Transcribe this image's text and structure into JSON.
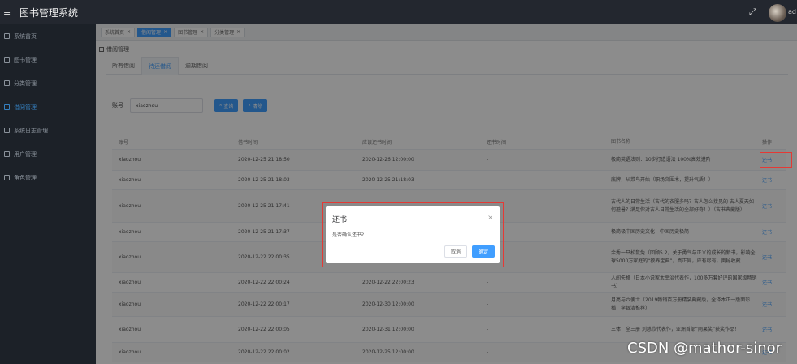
{
  "header": {
    "title": "图书管理系统",
    "menu_icon": "≡",
    "fullscreen_icon": "⤢",
    "user_partial": "ad"
  },
  "sidebar": {
    "items": [
      {
        "label": "系统首页"
      },
      {
        "label": "图书管理"
      },
      {
        "label": "分类管理"
      },
      {
        "label": "借阅管理"
      },
      {
        "label": "系统日志管理"
      },
      {
        "label": "用户管理"
      },
      {
        "label": "角色管理"
      }
    ],
    "active_index": 3
  },
  "page_tabs": [
    {
      "label": "系统首页"
    },
    {
      "label": "借阅管理"
    },
    {
      "label": "图书管理"
    },
    {
      "label": "分类管理"
    }
  ],
  "breadcrumb": "借阅管理",
  "sub_tabs": [
    "所有借阅",
    "待还借阅",
    "逾期借阅"
  ],
  "search": {
    "label": "账号",
    "value": "xiaozhou",
    "query_btn": "查询",
    "reset_btn": "清除"
  },
  "table": {
    "headers": [
      "账号",
      "借书时间",
      "应该还书时间",
      "还书时间",
      "图书名称",
      "操作"
    ],
    "rows": [
      {
        "account": "xiaozhou",
        "borrow_time": "2020-12-25 21:18:50",
        "due_time": "2020-12-26 12:00:00",
        "return_time": "-",
        "book": "极简英语法则：10步打造语法 100%高效进阶",
        "action": "还书"
      },
      {
        "account": "xiaozhou",
        "borrow_time": "2020-12-25 21:18:03",
        "due_time": "2020-12-25 21:18:03",
        "return_time": "-",
        "book": "底牌，从菜鸟开始（职场突围术，提升气质！）",
        "action": "还书"
      },
      {
        "account": "xiaozhou",
        "borrow_time": "2020-12-25 21:17:41",
        "due_time": "",
        "return_time": "-",
        "book": "古代人的日常生活（古代的衣服多吗？古人怎么接见的 古人夏天如何避暑？满足你对古人日常生活的全部好奇！）（古书典藏版）",
        "action": "还书"
      },
      {
        "account": "xiaozhou",
        "borrow_time": "2020-12-25 21:17:37",
        "due_time": "",
        "return_time": "",
        "book": "极简极中国历史文化：中国历史极简",
        "action": "还书"
      },
      {
        "account": "xiaozhou",
        "borrow_time": "2020-12-22 22:00:35",
        "due_time": "",
        "return_time": "",
        "book": "余秀一只松鼠兔（回顾5.2，关于勇气与正义的成长的新书，影响全球5000万家庭的“教养宝典”，真正同，应有尽有，奥秘收藏",
        "action": "还书"
      },
      {
        "account": "xiaozhou",
        "borrow_time": "2020-12-22 22:00:24",
        "due_time": "2020-12-22 22:00:23",
        "return_time": "-",
        "book": "人间失格（日本小说家太宰治代表作，100多万套好评的国家级畅销书）",
        "action": "还书"
      },
      {
        "account": "xiaozhou",
        "borrow_time": "2020-12-22 22:00:17",
        "due_time": "2020-12-30 12:00:00",
        "return_time": "-",
        "book": "月亮与六便士（2019畅销百万册精装典藏版，全译本正一版面彩插，李银清推荐）",
        "action": "还书"
      },
      {
        "account": "xiaozhou",
        "borrow_time": "2020-12-22 22:00:05",
        "due_time": "2020-12-31 12:00:00",
        "return_time": "-",
        "book": "三体：全三册 刘慈欣代表作，亚洲首部“雨果奖”获奖作品！",
        "action": "还书"
      },
      {
        "account": "xiaozhou",
        "borrow_time": "2020-12-22 22:00:02",
        "due_time": "2020-12-25 12:00:00",
        "return_time": "-",
        "book": "",
        "action": "还书"
      }
    ]
  },
  "dialog": {
    "title": "还书",
    "message": "是否确认还书?",
    "cancel": "取消",
    "ok": "确定",
    "close_icon": "×"
  },
  "watermark": "CSDN @mathor-sinor",
  "colors": {
    "primary": "#409eff",
    "highlight": "#e53935",
    "header_bg": "#23272f",
    "sidebar_bg": "#20252d"
  }
}
